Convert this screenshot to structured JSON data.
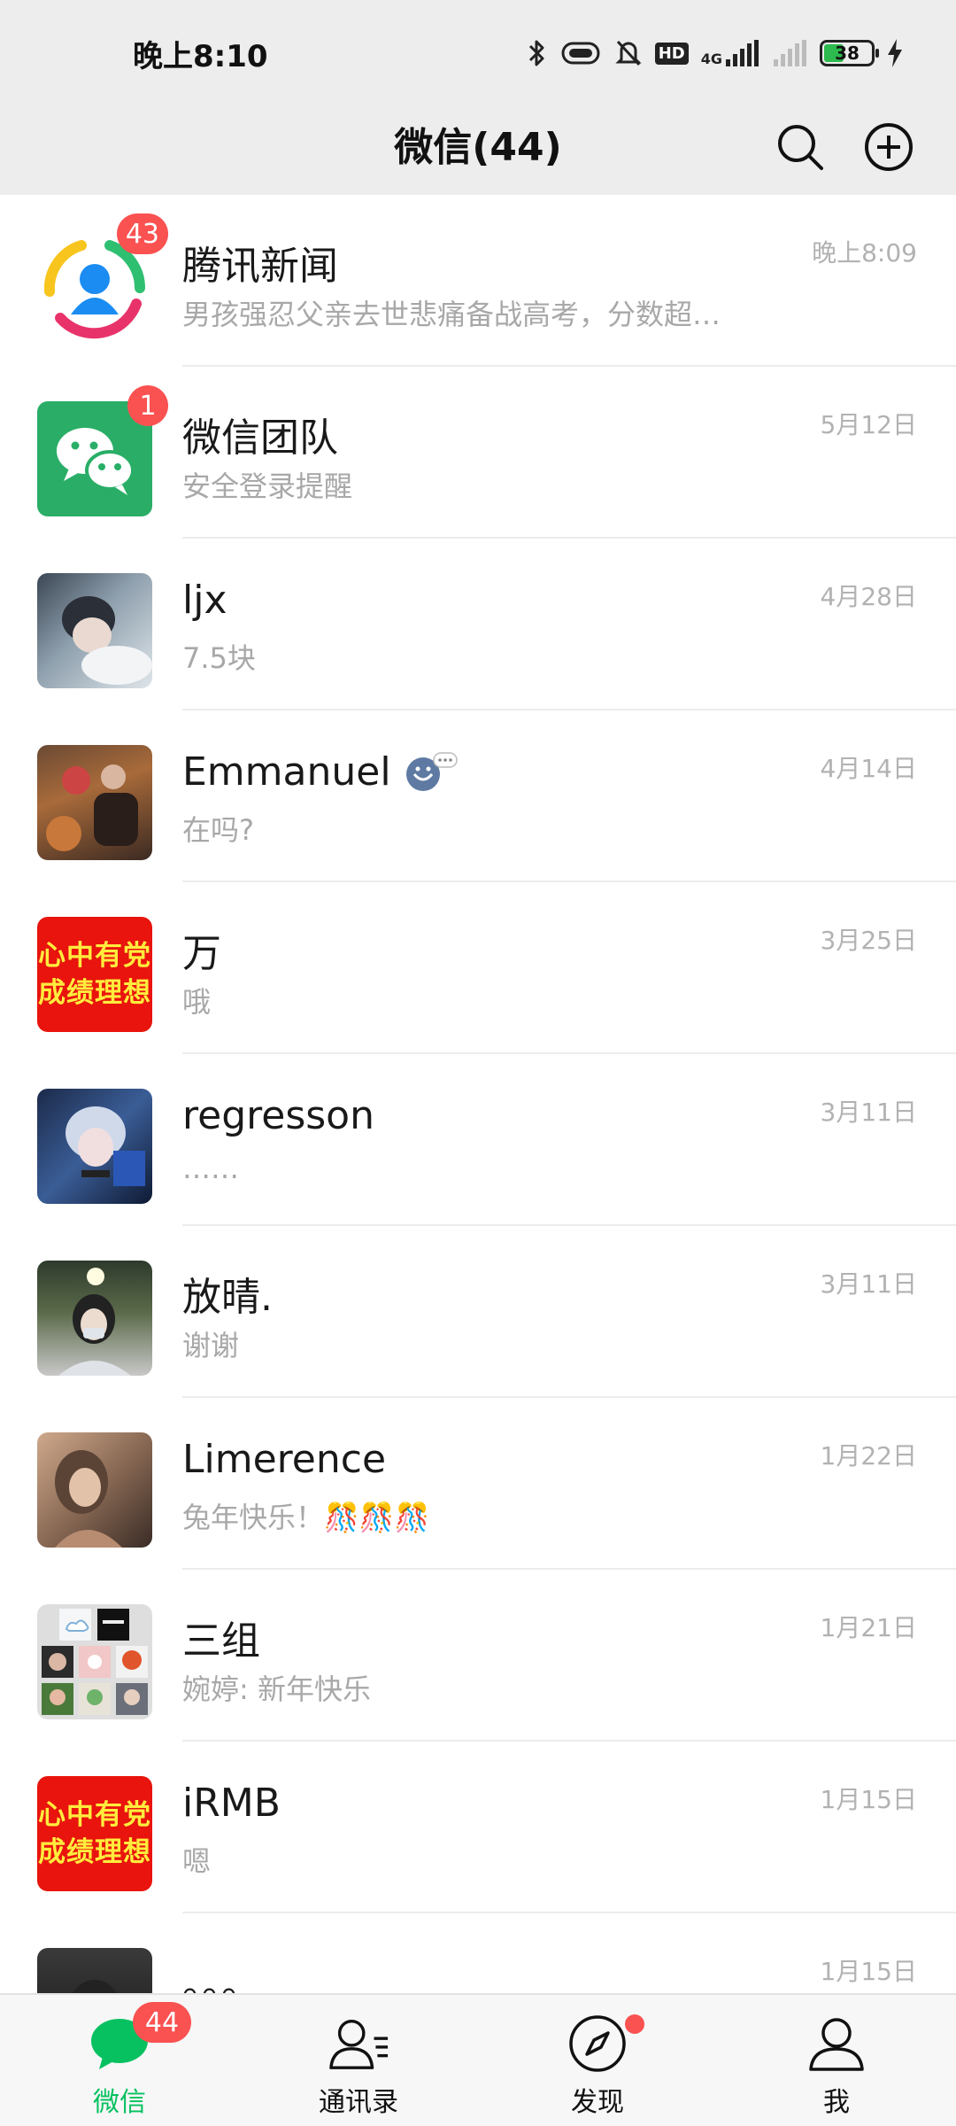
{
  "status_bar": {
    "time": "晚上8:10",
    "hd": "HD",
    "network": "4G",
    "battery": "38"
  },
  "header": {
    "title": "微信(44)",
    "search_icon": "search-icon",
    "add_icon": "plus-circle-icon"
  },
  "chats": [
    {
      "name": "腾讯新闻",
      "preview": "男孩强忍父亲去世悲痛备战高考，分数超…",
      "time": "晚上8:09",
      "badge": "43"
    },
    {
      "name": "微信团队",
      "preview": "安全登录提醒",
      "time": "5月12日",
      "badge": "1"
    },
    {
      "name": "ljx",
      "preview": "7.5块",
      "time": "4月28日"
    },
    {
      "name": "Emmanuel",
      "preview": "在吗?",
      "time": "4月14日",
      "name_icon": "smiley-bubble-icon"
    },
    {
      "name": "万",
      "preview": "哦",
      "time": "3月25日",
      "avatar_text": [
        "心中有党",
        "成绩理想"
      ]
    },
    {
      "name": "regresson",
      "preview": "……",
      "time": "3月11日"
    },
    {
      "name": "放晴.",
      "preview": "谢谢",
      "time": "3月11日"
    },
    {
      "name": "Limerence",
      "preview": "兔年快乐！🎊🎊🎊",
      "time": "1月22日"
    },
    {
      "name": "三组",
      "preview": "婉婷: 新年快乐",
      "time": "1月21日"
    },
    {
      "name": "iRMB",
      "preview": "嗯",
      "time": "1月15日",
      "avatar_text": [
        "心中有党",
        "成绩理想"
      ]
    },
    {
      "name": "。。。",
      "preview": "",
      "time": "1月15日"
    }
  ],
  "tabs": [
    {
      "label": "微信",
      "icon": "chat-bubble-icon",
      "badge": "44",
      "active": true
    },
    {
      "label": "通讯录",
      "icon": "contacts-icon"
    },
    {
      "label": "发现",
      "icon": "compass-icon",
      "dot": true
    },
    {
      "label": "我",
      "icon": "person-icon"
    }
  ],
  "colors": {
    "accent": "#07c160",
    "badge": "#fa5151",
    "header_bg": "#ededed",
    "muted_text": "#a8a8a8"
  }
}
